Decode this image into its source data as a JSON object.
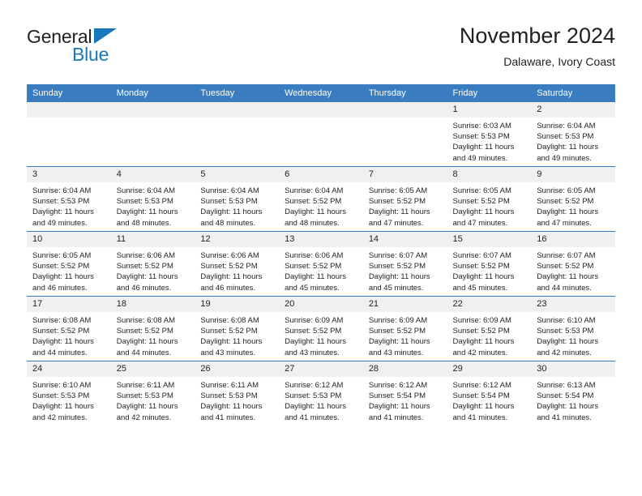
{
  "brand": {
    "name_part1": "General",
    "name_part2": "Blue",
    "triangle_color": "#1878be"
  },
  "header": {
    "title": "November 2024",
    "subtitle": "Dalaware, Ivory Coast"
  },
  "theme": {
    "header_bg": "#3a7cc0",
    "daynum_bg": "#f0f0f0",
    "text": "#231f20"
  },
  "weekdays": [
    "Sunday",
    "Monday",
    "Tuesday",
    "Wednesday",
    "Thursday",
    "Friday",
    "Saturday"
  ],
  "weeks": [
    [
      {
        "day": "",
        "empty": true
      },
      {
        "day": "",
        "empty": true
      },
      {
        "day": "",
        "empty": true
      },
      {
        "day": "",
        "empty": true
      },
      {
        "day": "",
        "empty": true
      },
      {
        "day": "1",
        "sunrise": "Sunrise: 6:03 AM",
        "sunset": "Sunset: 5:53 PM",
        "daylight": "Daylight: 11 hours and 49 minutes."
      },
      {
        "day": "2",
        "sunrise": "Sunrise: 6:04 AM",
        "sunset": "Sunset: 5:53 PM",
        "daylight": "Daylight: 11 hours and 49 minutes."
      }
    ],
    [
      {
        "day": "3",
        "sunrise": "Sunrise: 6:04 AM",
        "sunset": "Sunset: 5:53 PM",
        "daylight": "Daylight: 11 hours and 49 minutes."
      },
      {
        "day": "4",
        "sunrise": "Sunrise: 6:04 AM",
        "sunset": "Sunset: 5:53 PM",
        "daylight": "Daylight: 11 hours and 48 minutes."
      },
      {
        "day": "5",
        "sunrise": "Sunrise: 6:04 AM",
        "sunset": "Sunset: 5:53 PM",
        "daylight": "Daylight: 11 hours and 48 minutes."
      },
      {
        "day": "6",
        "sunrise": "Sunrise: 6:04 AM",
        "sunset": "Sunset: 5:52 PM",
        "daylight": "Daylight: 11 hours and 48 minutes."
      },
      {
        "day": "7",
        "sunrise": "Sunrise: 6:05 AM",
        "sunset": "Sunset: 5:52 PM",
        "daylight": "Daylight: 11 hours and 47 minutes."
      },
      {
        "day": "8",
        "sunrise": "Sunrise: 6:05 AM",
        "sunset": "Sunset: 5:52 PM",
        "daylight": "Daylight: 11 hours and 47 minutes."
      },
      {
        "day": "9",
        "sunrise": "Sunrise: 6:05 AM",
        "sunset": "Sunset: 5:52 PM",
        "daylight": "Daylight: 11 hours and 47 minutes."
      }
    ],
    [
      {
        "day": "10",
        "sunrise": "Sunrise: 6:05 AM",
        "sunset": "Sunset: 5:52 PM",
        "daylight": "Daylight: 11 hours and 46 minutes."
      },
      {
        "day": "11",
        "sunrise": "Sunrise: 6:06 AM",
        "sunset": "Sunset: 5:52 PM",
        "daylight": "Daylight: 11 hours and 46 minutes."
      },
      {
        "day": "12",
        "sunrise": "Sunrise: 6:06 AM",
        "sunset": "Sunset: 5:52 PM",
        "daylight": "Daylight: 11 hours and 46 minutes."
      },
      {
        "day": "13",
        "sunrise": "Sunrise: 6:06 AM",
        "sunset": "Sunset: 5:52 PM",
        "daylight": "Daylight: 11 hours and 45 minutes."
      },
      {
        "day": "14",
        "sunrise": "Sunrise: 6:07 AM",
        "sunset": "Sunset: 5:52 PM",
        "daylight": "Daylight: 11 hours and 45 minutes."
      },
      {
        "day": "15",
        "sunrise": "Sunrise: 6:07 AM",
        "sunset": "Sunset: 5:52 PM",
        "daylight": "Daylight: 11 hours and 45 minutes."
      },
      {
        "day": "16",
        "sunrise": "Sunrise: 6:07 AM",
        "sunset": "Sunset: 5:52 PM",
        "daylight": "Daylight: 11 hours and 44 minutes."
      }
    ],
    [
      {
        "day": "17",
        "sunrise": "Sunrise: 6:08 AM",
        "sunset": "Sunset: 5:52 PM",
        "daylight": "Daylight: 11 hours and 44 minutes."
      },
      {
        "day": "18",
        "sunrise": "Sunrise: 6:08 AM",
        "sunset": "Sunset: 5:52 PM",
        "daylight": "Daylight: 11 hours and 44 minutes."
      },
      {
        "day": "19",
        "sunrise": "Sunrise: 6:08 AM",
        "sunset": "Sunset: 5:52 PM",
        "daylight": "Daylight: 11 hours and 43 minutes."
      },
      {
        "day": "20",
        "sunrise": "Sunrise: 6:09 AM",
        "sunset": "Sunset: 5:52 PM",
        "daylight": "Daylight: 11 hours and 43 minutes."
      },
      {
        "day": "21",
        "sunrise": "Sunrise: 6:09 AM",
        "sunset": "Sunset: 5:52 PM",
        "daylight": "Daylight: 11 hours and 43 minutes."
      },
      {
        "day": "22",
        "sunrise": "Sunrise: 6:09 AM",
        "sunset": "Sunset: 5:52 PM",
        "daylight": "Daylight: 11 hours and 42 minutes."
      },
      {
        "day": "23",
        "sunrise": "Sunrise: 6:10 AM",
        "sunset": "Sunset: 5:53 PM",
        "daylight": "Daylight: 11 hours and 42 minutes."
      }
    ],
    [
      {
        "day": "24",
        "sunrise": "Sunrise: 6:10 AM",
        "sunset": "Sunset: 5:53 PM",
        "daylight": "Daylight: 11 hours and 42 minutes."
      },
      {
        "day": "25",
        "sunrise": "Sunrise: 6:11 AM",
        "sunset": "Sunset: 5:53 PM",
        "daylight": "Daylight: 11 hours and 42 minutes."
      },
      {
        "day": "26",
        "sunrise": "Sunrise: 6:11 AM",
        "sunset": "Sunset: 5:53 PM",
        "daylight": "Daylight: 11 hours and 41 minutes."
      },
      {
        "day": "27",
        "sunrise": "Sunrise: 6:12 AM",
        "sunset": "Sunset: 5:53 PM",
        "daylight": "Daylight: 11 hours and 41 minutes."
      },
      {
        "day": "28",
        "sunrise": "Sunrise: 6:12 AM",
        "sunset": "Sunset: 5:54 PM",
        "daylight": "Daylight: 11 hours and 41 minutes."
      },
      {
        "day": "29",
        "sunrise": "Sunrise: 6:12 AM",
        "sunset": "Sunset: 5:54 PM",
        "daylight": "Daylight: 11 hours and 41 minutes."
      },
      {
        "day": "30",
        "sunrise": "Sunrise: 6:13 AM",
        "sunset": "Sunset: 5:54 PM",
        "daylight": "Daylight: 11 hours and 41 minutes."
      }
    ]
  ]
}
